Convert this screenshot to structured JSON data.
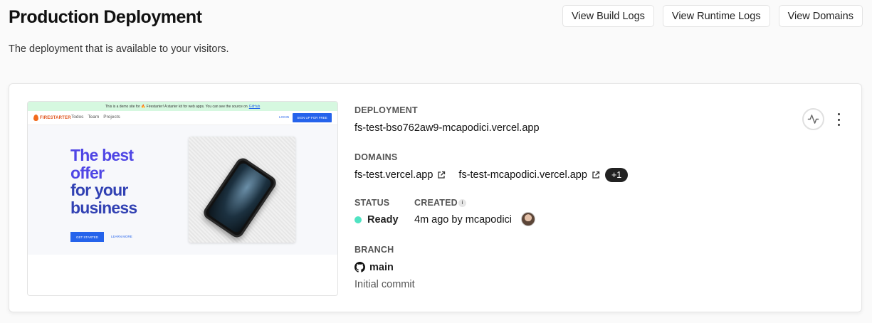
{
  "header": {
    "title": "Production Deployment",
    "subtitle": "The deployment that is available to your visitors.",
    "buttons": {
      "build_logs": "View Build Logs",
      "runtime_logs": "View Runtime Logs",
      "domains": "View Domains"
    }
  },
  "preview": {
    "banner_text": "This is a demo site for 🔥 Firestarter! A starter kit for web apps. You can see the source on",
    "banner_link": "GitHub",
    "logo_text": "FIRESTARTER",
    "nav_links": [
      "Todos",
      "Team",
      "Projects"
    ],
    "login_label": "LOGIN",
    "signup_label": "SIGN UP FOR FREE",
    "headline_lines": [
      "The best",
      "offer",
      "for your",
      "business"
    ],
    "cta_label": "GET STARTED",
    "learn_more_label": "LEARN MORE"
  },
  "deployment": {
    "label": "DEPLOYMENT",
    "url": "fs-test-bso762aw9-mcapodici.vercel.app"
  },
  "domains": {
    "label": "DOMAINS",
    "items": [
      "fs-test.vercel.app",
      "fs-test-mcapodici.vercel.app"
    ],
    "more_badge": "+1"
  },
  "status": {
    "label": "STATUS",
    "value": "Ready",
    "color": "#50e3c2"
  },
  "created": {
    "label": "CREATED",
    "info_glyph": "i",
    "value": "4m ago by mcapodici"
  },
  "branch": {
    "label": "BRANCH",
    "name": "main",
    "commit": "Initial commit"
  },
  "icons": {
    "activity": "activity-icon",
    "more": "more-vertical-icon",
    "external": "external-link-icon",
    "github": "github-icon"
  }
}
